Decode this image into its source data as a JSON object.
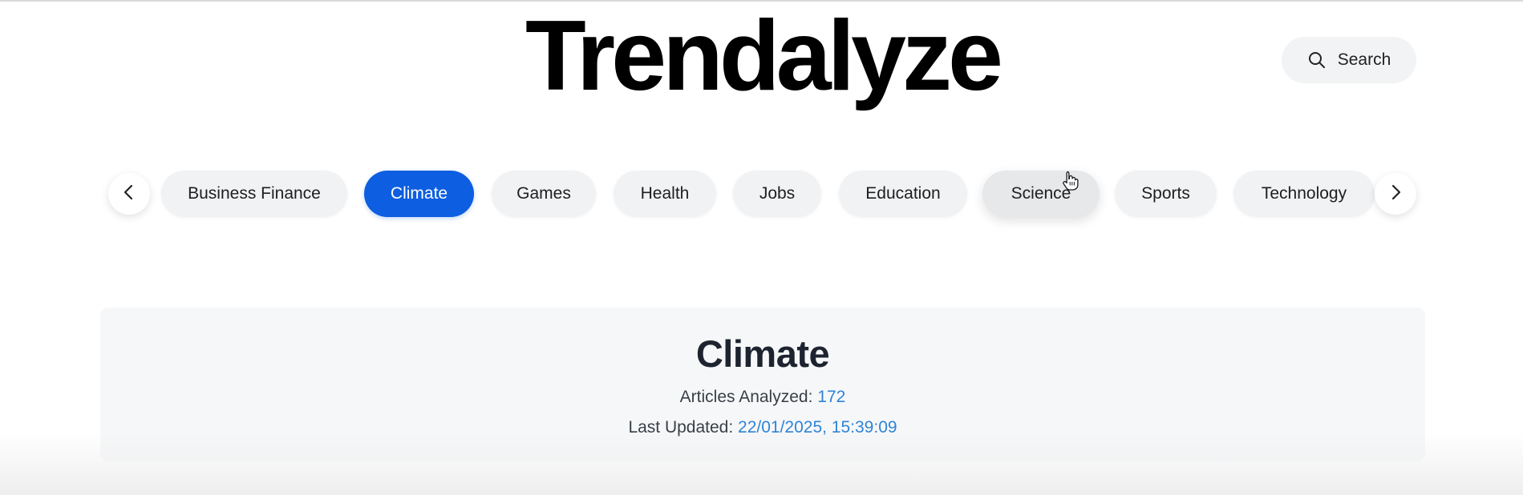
{
  "app": {
    "brand": "Trendalyze"
  },
  "header": {
    "search_label": "Search",
    "search_icon": "search-icon"
  },
  "categories": {
    "prev_icon": "chevron-left-icon",
    "next_icon": "chevron-right-icon",
    "items": [
      {
        "label": "Business Finance"
      },
      {
        "label": "Climate",
        "state": "selected"
      },
      {
        "label": "Games"
      },
      {
        "label": "Health"
      },
      {
        "label": "Jobs"
      },
      {
        "label": "Education"
      },
      {
        "label": "Science",
        "state": "hovered"
      },
      {
        "label": "Sports"
      },
      {
        "label": "Technology"
      }
    ],
    "active_color": "#0d5ee0"
  },
  "summary": {
    "title": "Climate",
    "articles_label": "Articles Analyzed: ",
    "articles_value": "172",
    "updated_label": "Last Updated: ",
    "updated_value": "22/01/2025, 15:39:09",
    "value_color": "#2f84d6"
  },
  "cursor": {
    "icon": "hand-pointer-icon"
  }
}
